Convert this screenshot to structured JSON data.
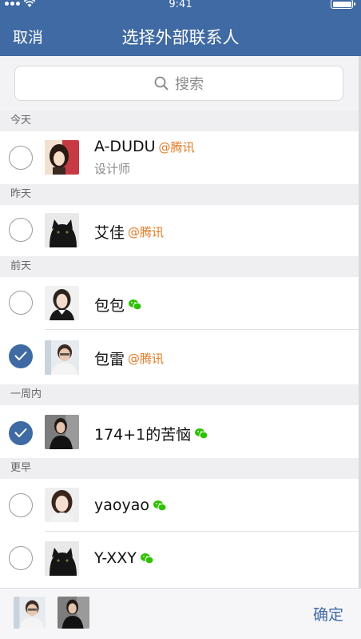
{
  "status": {
    "time": "9:41",
    "battery_level": 1.0
  },
  "nav": {
    "cancel": "取消",
    "title": "选择外部联系人"
  },
  "search": {
    "placeholder": "搜索"
  },
  "sections": {
    "today": "今天",
    "yesterday": "昨天",
    "day_before": "前天",
    "this_week": "一周内",
    "earlier": "更早"
  },
  "contacts": [
    {
      "name": "A-DUDU",
      "org": "@腾讯",
      "subtitle": "设计师",
      "checked": false,
      "source": "tencent"
    },
    {
      "name": "艾佳",
      "org": "@腾讯",
      "checked": false,
      "source": "tencent"
    },
    {
      "name": "包包",
      "checked": false,
      "source": "wechat"
    },
    {
      "name": "包雷",
      "org": "@腾讯",
      "checked": true,
      "source": "tencent"
    },
    {
      "name": "174+1的苦恼",
      "checked": true,
      "source": "wechat"
    },
    {
      "name": "yaoyao",
      "checked": false,
      "source": "wechat"
    },
    {
      "name": "Y-XXY",
      "checked": false,
      "source": "wechat"
    }
  ],
  "footer": {
    "confirm": "确定",
    "selected_count": 2
  },
  "colors": {
    "brand": "#3f6aa3",
    "org": "#e07a24",
    "wechat": "#2dc100"
  },
  "icons": [
    "search-icon",
    "wechat-icon",
    "check-icon",
    "wifi-icon",
    "battery-icon"
  ]
}
